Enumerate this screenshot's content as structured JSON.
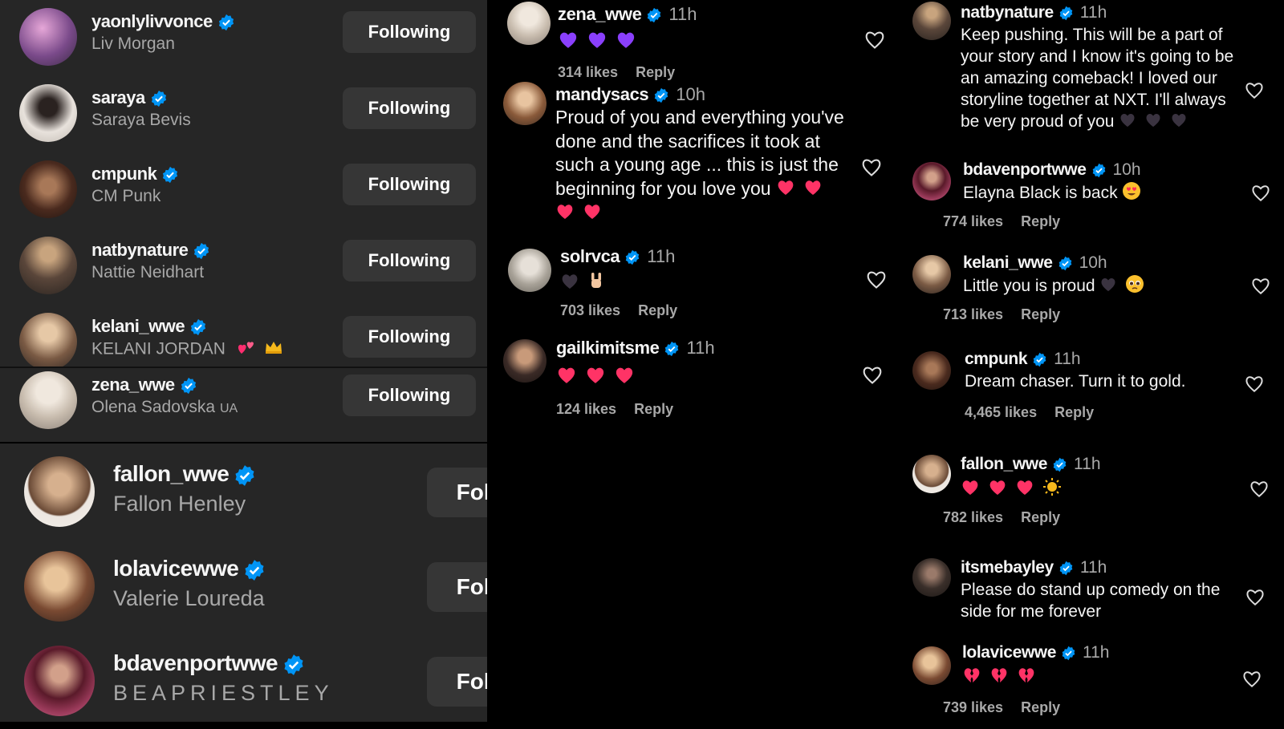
{
  "following_top": [
    {
      "username": "yaonlylivvonce",
      "full_name": "Liv Morgan",
      "button": "Following",
      "avatar_color": "#9b6a9e"
    },
    {
      "username": "saraya",
      "full_name": "Saraya Bevis",
      "button": "Following",
      "avatar_color": "#d9d4d0"
    },
    {
      "username": "cmpunk",
      "full_name": "CM Punk",
      "button": "Following",
      "avatar_color": "#5a3a2a"
    },
    {
      "username": "natbynature",
      "full_name": "Nattie Neidhart",
      "button": "Following",
      "avatar_color": "#6e5a4a"
    },
    {
      "username": "kelani_wwe",
      "full_name": "KELANI JORDAN",
      "button": "Following",
      "avatar_color": "#c4a890"
    },
    {
      "username": "zena_wwe",
      "full_name": "Olena Sadovska",
      "full_name_suffix": "UA",
      "button": "Following",
      "avatar_color": "#d8d2ca"
    }
  ],
  "following_bottom": [
    {
      "username": "fallon_wwe",
      "full_name": "Fallon Henley",
      "button": "Following",
      "avatar_color": "#caa98a"
    },
    {
      "username": "lolavicewwe",
      "full_name": "Valerie Loureda",
      "button": "Following",
      "avatar_color": "#b07a5a"
    },
    {
      "username": "bdavenportwwe",
      "full_name": "BEAPRIESTLEY",
      "button": "Following",
      "avatar_color": "#8a3a55"
    }
  ],
  "comments_middle": [
    {
      "username": "zena_wwe",
      "time": "11h",
      "text": "",
      "likes": "314 likes",
      "reply": "Reply",
      "avatar_color": "#d8d2ca"
    },
    {
      "username": "mandysacs",
      "time": "10h",
      "text": "Proud of you and everything you've done and the sacrifices it took at such a young age ... this is just the beginning for you love you",
      "likes": "",
      "reply": "",
      "avatar_color": "#b58a66"
    },
    {
      "username": "solrvca",
      "time": "11h",
      "text": "",
      "likes": "703 likes",
      "reply": "Reply",
      "avatar_color": "#c9c5bf"
    },
    {
      "username": "gailkimitsme",
      "time": "11h",
      "text": "",
      "likes": "124 likes",
      "reply": "Reply",
      "avatar_color": "#4a3a36"
    }
  ],
  "comments_right": [
    {
      "username": "natbynature",
      "time": "11h",
      "text": "Keep pushing. This will be a part of your story and I know it's going to be an amazing comeback! I loved our storyline together at NXT. I'll always be very proud of you",
      "likes": "",
      "reply": "",
      "avatar_color": "#6e5a4a"
    },
    {
      "username": "bdavenportwwe",
      "time": "10h",
      "text": "Elayna Black is back",
      "likes": "774 likes",
      "reply": "Reply",
      "avatar_color": "#8a3a55"
    },
    {
      "username": "kelani_wwe",
      "time": "10h",
      "text": "Little you is proud",
      "likes": "713 likes",
      "reply": "Reply",
      "avatar_color": "#c4a890"
    },
    {
      "username": "cmpunk",
      "time": "11h",
      "text": "Dream chaser. Turn it to gold.",
      "likes": "4,465 likes",
      "reply": "Reply",
      "avatar_color": "#5a3a2a"
    },
    {
      "username": "fallon_wwe",
      "time": "11h",
      "text": "",
      "likes": "782 likes",
      "reply": "Reply",
      "avatar_color": "#caa98a"
    },
    {
      "username": "itsmebayley",
      "time": "11h",
      "text": "Please do stand up comedy on the side for me forever",
      "likes": "",
      "reply": "",
      "avatar_color": "#4a3f3a"
    },
    {
      "username": "lolavicewwe",
      "time": "11h",
      "text": "",
      "likes": "739 likes",
      "reply": "Reply",
      "avatar_color": "#b07a5a"
    }
  ],
  "colors": {
    "verified": "#0095f6",
    "heart_red": "#ff3366",
    "heart_purple": "#8a3ffc",
    "heart_black": "#3a3340",
    "panel_bg": "#262626",
    "button_bg": "#363636"
  },
  "icons": [
    "verified-badge-icon",
    "like-heart-icon",
    "red-heart-emoji",
    "purple-heart-emoji",
    "black-heart-emoji",
    "crown-emoji",
    "two-hearts-emoji",
    "sun-emoji",
    "heart-eyes-emoji",
    "pleading-face-emoji",
    "horns-hand-emoji",
    "broken-heart-emoji"
  ]
}
